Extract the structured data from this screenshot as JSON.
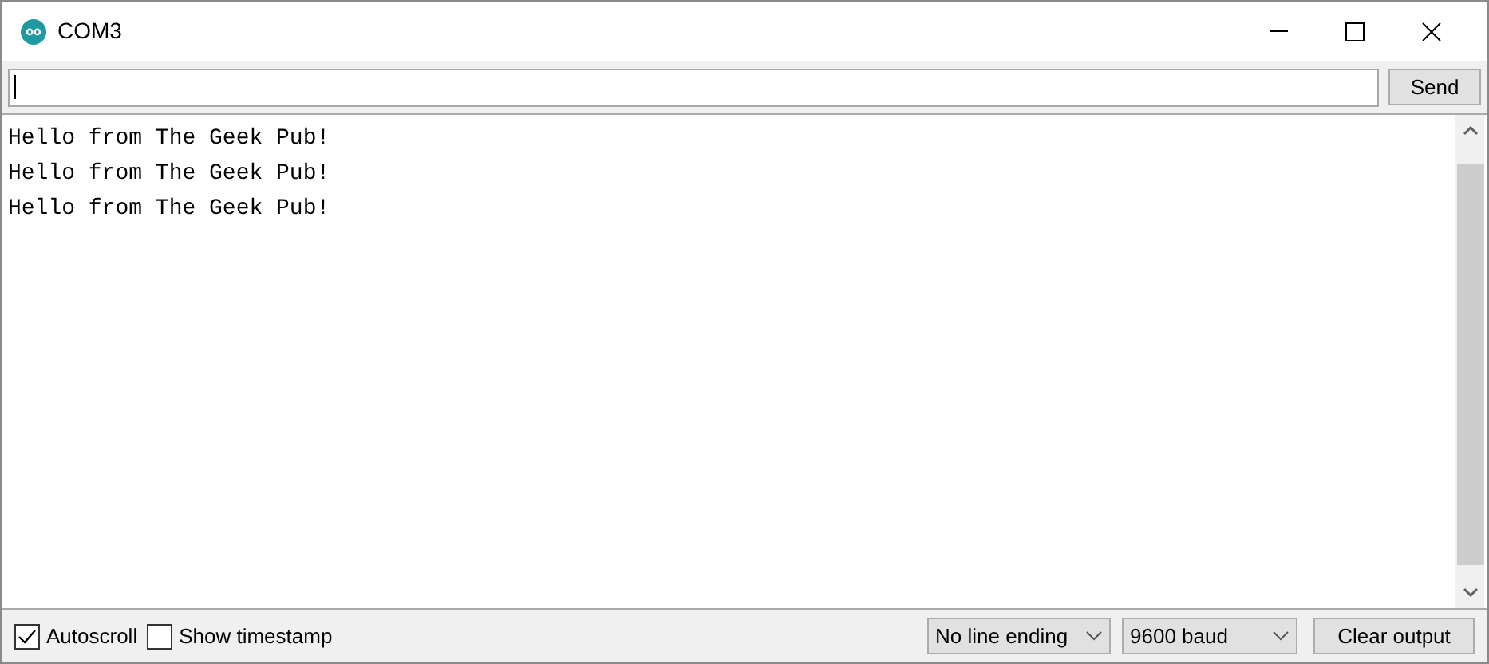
{
  "window": {
    "title": "COM3"
  },
  "input": {
    "button": "Send"
  },
  "output": {
    "lines": [
      "Hello from The Geek Pub!",
      "Hello from The Geek Pub!",
      "Hello from The Geek Pub!"
    ]
  },
  "footer": {
    "checkboxes": [
      {
        "label": "Autoscroll",
        "checked": true
      },
      {
        "label": "Show timestamp",
        "checked": false
      }
    ],
    "selects": [
      {
        "value": "No line ending"
      },
      {
        "value": "9600 baud"
      }
    ],
    "button": "Clear output"
  }
}
